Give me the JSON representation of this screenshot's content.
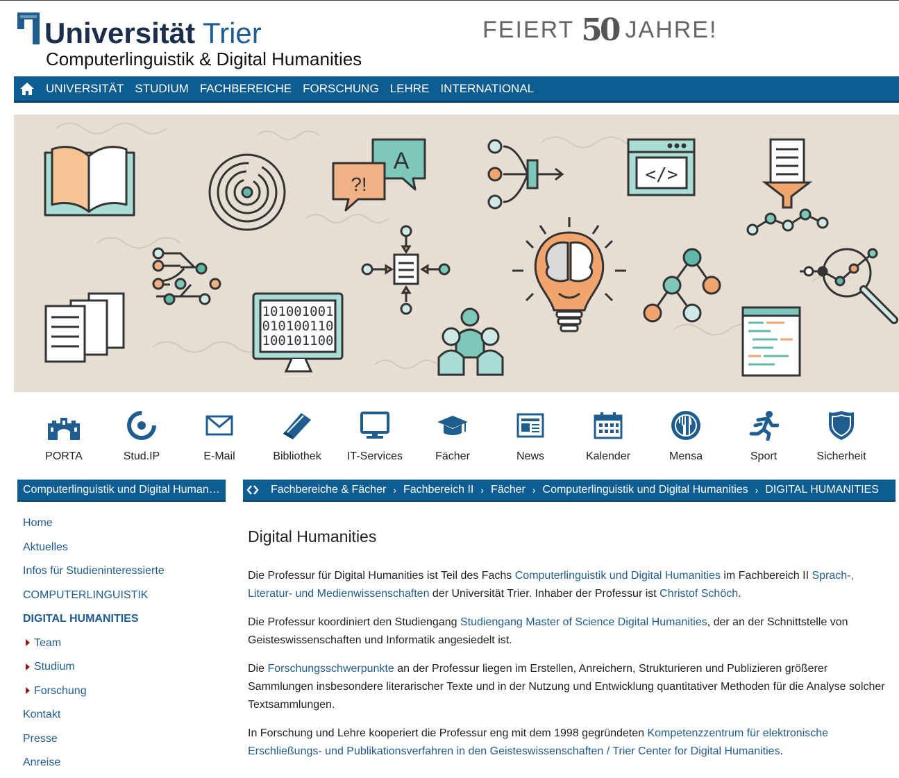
{
  "header": {
    "logo_university": "Universität",
    "logo_city": "Trier",
    "subtitle": "Computerlinguistik & Digital Humanities",
    "jubilee_prefix": "FEIERT",
    "jubilee_number": "50",
    "jubilee_suffix": "JAHRE!"
  },
  "mainnav": {
    "items": [
      "UNIVERSITÄT",
      "STUDIUM",
      "FACHBEREICHE",
      "FORSCHUNG",
      "LEHRE",
      "INTERNATIONAL"
    ]
  },
  "quicklinks": [
    {
      "label": "PORTA",
      "icon": "building-icon"
    },
    {
      "label": "Stud.IP",
      "icon": "studip-icon"
    },
    {
      "label": "E-Mail",
      "icon": "mail-icon"
    },
    {
      "label": "Bibliothek",
      "icon": "book-icon"
    },
    {
      "label": "IT-Services",
      "icon": "monitor-icon"
    },
    {
      "label": "Fächer",
      "icon": "graduation-cap-icon"
    },
    {
      "label": "News",
      "icon": "newspaper-icon"
    },
    {
      "label": "Kalender",
      "icon": "calendar-icon"
    },
    {
      "label": "Mensa",
      "icon": "cutlery-icon"
    },
    {
      "label": "Sport",
      "icon": "runner-icon"
    },
    {
      "label": "Sicherheit",
      "icon": "shield-icon"
    }
  ],
  "sidebar": {
    "heading": "Computerlinguistik und Digital Humanities",
    "items": [
      "Home",
      "Aktuelles",
      "Infos für Studieninteressierte",
      "COMPUTERLINGUISTIK",
      "DIGITAL HUMANITIES",
      "Team",
      "Studium",
      "Forschung",
      "Kontakt",
      "Presse",
      "Anreise"
    ]
  },
  "breadcrumb": {
    "items": [
      "Fachbereiche & Fächer",
      "Fachbereich II",
      "Fächer",
      "Computerlinguistik und Digital Humanities",
      "DIGITAL HUMANITIES"
    ]
  },
  "content": {
    "title": "Digital Humanities",
    "p1": {
      "t1": "Die Professur für Digital Humanities ist Teil des Fachs ",
      "l1": "Computerlinguistik und Digital Humanities",
      "t2": " im Fachbereich II ",
      "l2": "Sprach-, Literatur- und Medienwissenschaften",
      "t3": " der Universität Trier. Inhaber der Professur ist ",
      "l3": "Christof Schöch",
      "t4": "."
    },
    "p2": {
      "t1": "Die Professur koordiniert den Studiengang ",
      "l1": "Studiengang Master of Science Digital Humanities",
      "t2": ", der an der Schnittstelle von Geisteswissenschaften und Informatik angesiedelt ist."
    },
    "p3": {
      "t1": "Die ",
      "l1": "Forschungsschwerpunkte",
      "t2": " an der Professur liegen im Erstellen, Anreichern, Strukturieren und Publizieren größerer Sammlungen insbesondere literarischer Texte und in der Nutzung und Entwicklung quantitativer Methoden für die Analyse solcher Textsammlungen."
    },
    "p4": {
      "t1": "In Forschung und Lehre kooperiert die Professur eng mit dem 1998 gegründeten ",
      "l1": "Kompetenzzentrum für elektronische Erschließungs- und Publikationsverfahren in den Geisteswissenschaften / Trier Center for Digital Humanities",
      "t2": "."
    }
  },
  "banner_text": {
    "speech_q": "?!",
    "speech_a": "A",
    "binary_1": "101001001",
    "binary_2": "010100110",
    "binary_3": "100101100",
    "code": "</>"
  },
  "colors": {
    "nav_blue": "#0d5c92",
    "link_blue": "#1f5c8f",
    "teal": "#5fb8a8",
    "orange": "#f0a46e",
    "banner_bg": "#e6ddd3"
  }
}
